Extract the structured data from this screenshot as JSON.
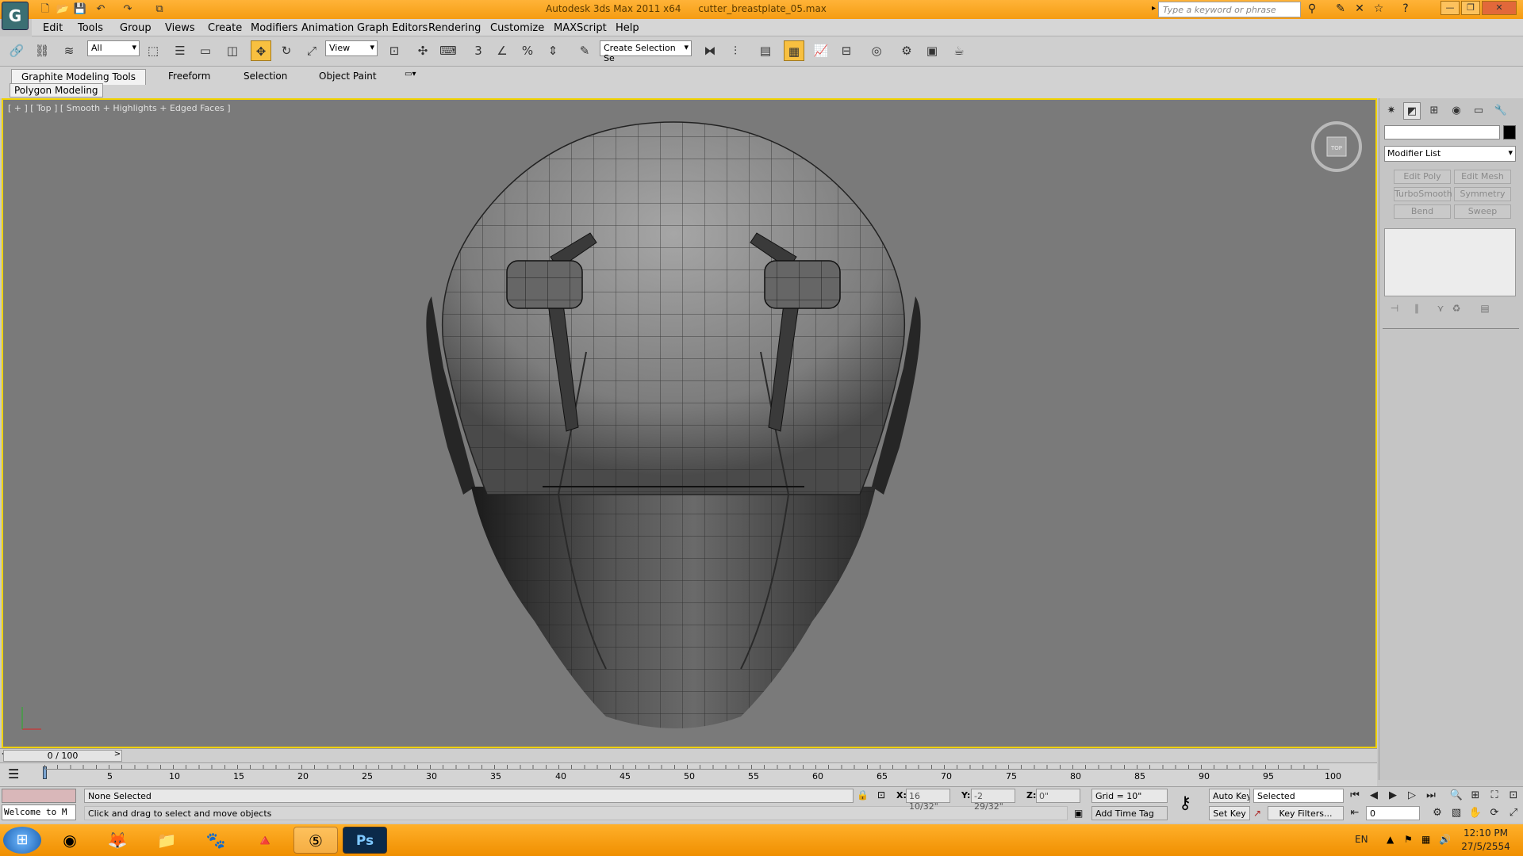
{
  "window": {
    "app_title": "Autodesk 3ds Max 2011 x64",
    "file_name": "cutter_breastplate_05.max",
    "search_placeholder": "Type a keyword or phrase"
  },
  "menu": [
    "Edit",
    "Tools",
    "Group",
    "Views",
    "Create",
    "Modifiers",
    "Animation",
    "Graph Editors",
    "Rendering",
    "Customize",
    "MAXScript",
    "Help"
  ],
  "toolbar": {
    "selection_filter": "All",
    "ref_coord": "View",
    "named_selection": "Create Selection Se",
    "snap_label": "3",
    "percent_label": "%"
  },
  "ribbon": {
    "tabs": [
      "Graphite Modeling Tools",
      "Freeform",
      "Selection",
      "Object Paint"
    ],
    "panel": "Polygon Modeling"
  },
  "viewport": {
    "label": "[ + ] [ Top ] [ Smooth + Highlights + Edged Faces ]",
    "viewcube_label": "TOP",
    "border_color": "#f0d200",
    "background": "#7a7a7a"
  },
  "command_panel": {
    "modifier_list": "Modifier List",
    "buttons": [
      "Edit Poly",
      "Edit Mesh",
      "TurboSmooth",
      "Symmetry",
      "Bend",
      "Sweep"
    ]
  },
  "timeline": {
    "slider": "0 / 100",
    "ticks": [
      "5",
      "10",
      "15",
      "20",
      "25",
      "30",
      "35",
      "40",
      "45",
      "50",
      "55",
      "60",
      "65",
      "70",
      "75",
      "80",
      "85",
      "90",
      "95",
      "100"
    ]
  },
  "status": {
    "maxscript": "Welcome to M",
    "selection": "None Selected",
    "prompt": "Click and drag to select and move objects",
    "x_label": "X:",
    "x_value": "16 10/32\"",
    "y_label": "Y:",
    "y_value": "-2 29/32\"",
    "z_label": "Z:",
    "z_value": "0\"",
    "grid": "Grid = 10\"",
    "add_time_tag": "Add Time Tag",
    "auto_key": "Auto Key",
    "set_key": "Set Key",
    "key_mode": "Selected",
    "key_filters": "Key Filters...",
    "frame": "0"
  },
  "taskbar": {
    "lang": "EN",
    "time": "12:10 PM",
    "date": "27/5/2554",
    "apps": [
      "chrome-icon",
      "firefox-icon",
      "explorer-icon",
      "gimp-icon",
      "vlc-icon",
      "3dsmax-icon",
      "photoshop-icon"
    ],
    "photoshop_label": "Ps"
  }
}
